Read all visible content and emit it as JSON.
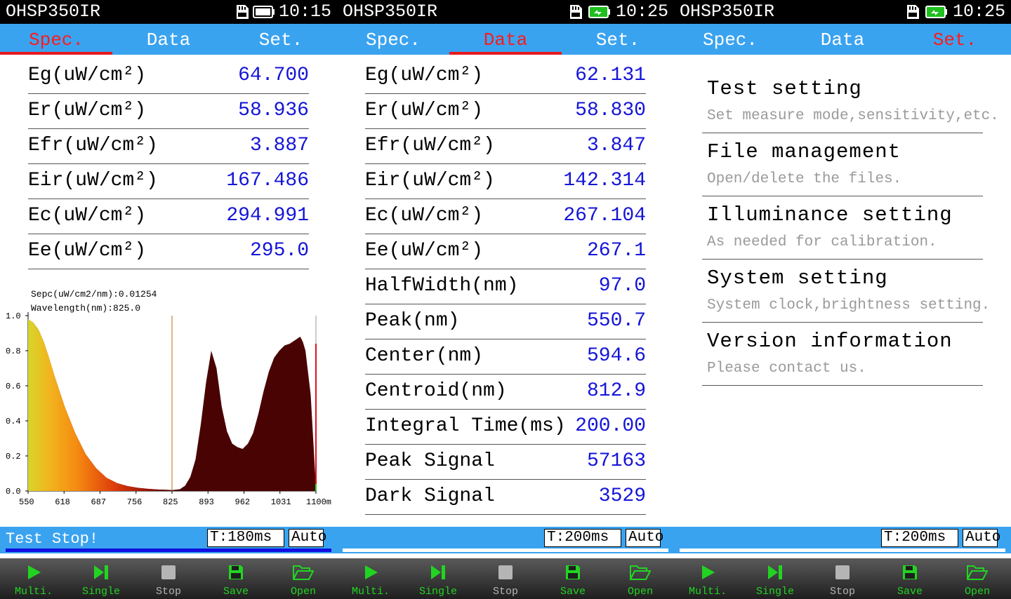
{
  "statusbar": {
    "device": "OHSP350IR",
    "panels": [
      {
        "time": "10:15",
        "battery": "white"
      },
      {
        "time": "10:25",
        "battery": "green"
      },
      {
        "time": "10:25",
        "battery": "green"
      }
    ]
  },
  "tabs": [
    "Spec.",
    "Data",
    "Set."
  ],
  "panel1": {
    "rows": [
      {
        "label": "Eg(uW/cm²)",
        "value": "64.700"
      },
      {
        "label": "Er(uW/cm²)",
        "value": "58.936"
      },
      {
        "label": "Efr(uW/cm²)",
        "value": "3.887"
      },
      {
        "label": "Eir(uW/cm²)",
        "value": "167.486"
      },
      {
        "label": "Ec(uW/cm²)",
        "value": "294.991"
      },
      {
        "label": "Ee(uW/cm²)",
        "value": "295.0"
      }
    ],
    "chart_readout": {
      "spec": "Sepc(uW/cm2/nm):0.01254",
      "wavelength": "Wavelength(nm):825.0"
    },
    "footer": {
      "status": "Test Stop!",
      "integration": "T:180ms",
      "mode": "Auto"
    }
  },
  "panel2": {
    "rows": [
      {
        "label": "Eg(uW/cm²)",
        "value": "62.131"
      },
      {
        "label": "Er(uW/cm²)",
        "value": "58.830"
      },
      {
        "label": "Efr(uW/cm²)",
        "value": "3.847"
      },
      {
        "label": "Eir(uW/cm²)",
        "value": "142.314"
      },
      {
        "label": "Ec(uW/cm²)",
        "value": "267.104"
      },
      {
        "label": "Ee(uW/cm²)",
        "value": "267.1"
      },
      {
        "label": "HalfWidth(nm)",
        "value": "97.0"
      },
      {
        "label": "Peak(nm)",
        "value": "550.7"
      },
      {
        "label": "Center(nm)",
        "value": "594.6"
      },
      {
        "label": "Centroid(nm)",
        "value": "812.9"
      },
      {
        "label": "Integral Time(ms)",
        "value": "200.00"
      },
      {
        "label": "Peak Signal",
        "value": "57163"
      },
      {
        "label": "Dark Signal",
        "value": "3529"
      }
    ],
    "footer": {
      "status": "",
      "integration": "T:200ms",
      "mode": "Auto"
    }
  },
  "panel3": {
    "menu": [
      {
        "title": "Test setting",
        "subtitle": "Set measure mode,sensitivity,etc."
      },
      {
        "title": "File management",
        "subtitle": "Open/delete the files."
      },
      {
        "title": "Illuminance setting",
        "subtitle": "As needed for calibration."
      },
      {
        "title": "System setting",
        "subtitle": "System clock,brightness setting."
      },
      {
        "title": "Version information",
        "subtitle": "Please contact us."
      }
    ],
    "footer": {
      "status": "",
      "integration": "T:200ms",
      "mode": "Auto"
    }
  },
  "toolbar": [
    "Multi.",
    "Single",
    "Stop",
    "Save",
    "Open"
  ],
  "colors": {
    "accent": "#3aa3f0",
    "active_tab": "#ff1a1a",
    "value": "#1414d8",
    "toolbar_text": "#22d422"
  },
  "chart_data": {
    "type": "area",
    "x_ticks": [
      "550",
      "618",
      "687",
      "756",
      "825",
      "893",
      "962",
      "1031",
      "1100m"
    ],
    "y_ticks": [
      "1.0",
      "0.8",
      "0.6",
      "0.4",
      "0.2",
      "0.0"
    ],
    "xlim": [
      550,
      1100
    ],
    "ylim": [
      0,
      1.0
    ],
    "cursor_x": 825,
    "series": [
      {
        "x": [
          550,
          560,
          570,
          580,
          590,
          600,
          620,
          640,
          660,
          680,
          700,
          720,
          740,
          760,
          780,
          800,
          820,
          825,
          840,
          850,
          860,
          870,
          880,
          890,
          900,
          910,
          920,
          930,
          940,
          950,
          960,
          970,
          980,
          990,
          1000,
          1010,
          1020,
          1030,
          1040,
          1050,
          1060,
          1070,
          1075,
          1080,
          1090,
          1100
        ],
        "y": [
          0.98,
          0.96,
          0.92,
          0.85,
          0.76,
          0.66,
          0.48,
          0.33,
          0.21,
          0.13,
          0.075,
          0.045,
          0.028,
          0.018,
          0.012,
          0.008,
          0.006,
          0.005,
          0.01,
          0.03,
          0.08,
          0.18,
          0.38,
          0.62,
          0.8,
          0.7,
          0.48,
          0.34,
          0.27,
          0.25,
          0.24,
          0.27,
          0.33,
          0.44,
          0.57,
          0.68,
          0.76,
          0.8,
          0.83,
          0.84,
          0.86,
          0.88,
          0.85,
          0.8,
          0.55,
          0.02
        ]
      }
    ]
  }
}
